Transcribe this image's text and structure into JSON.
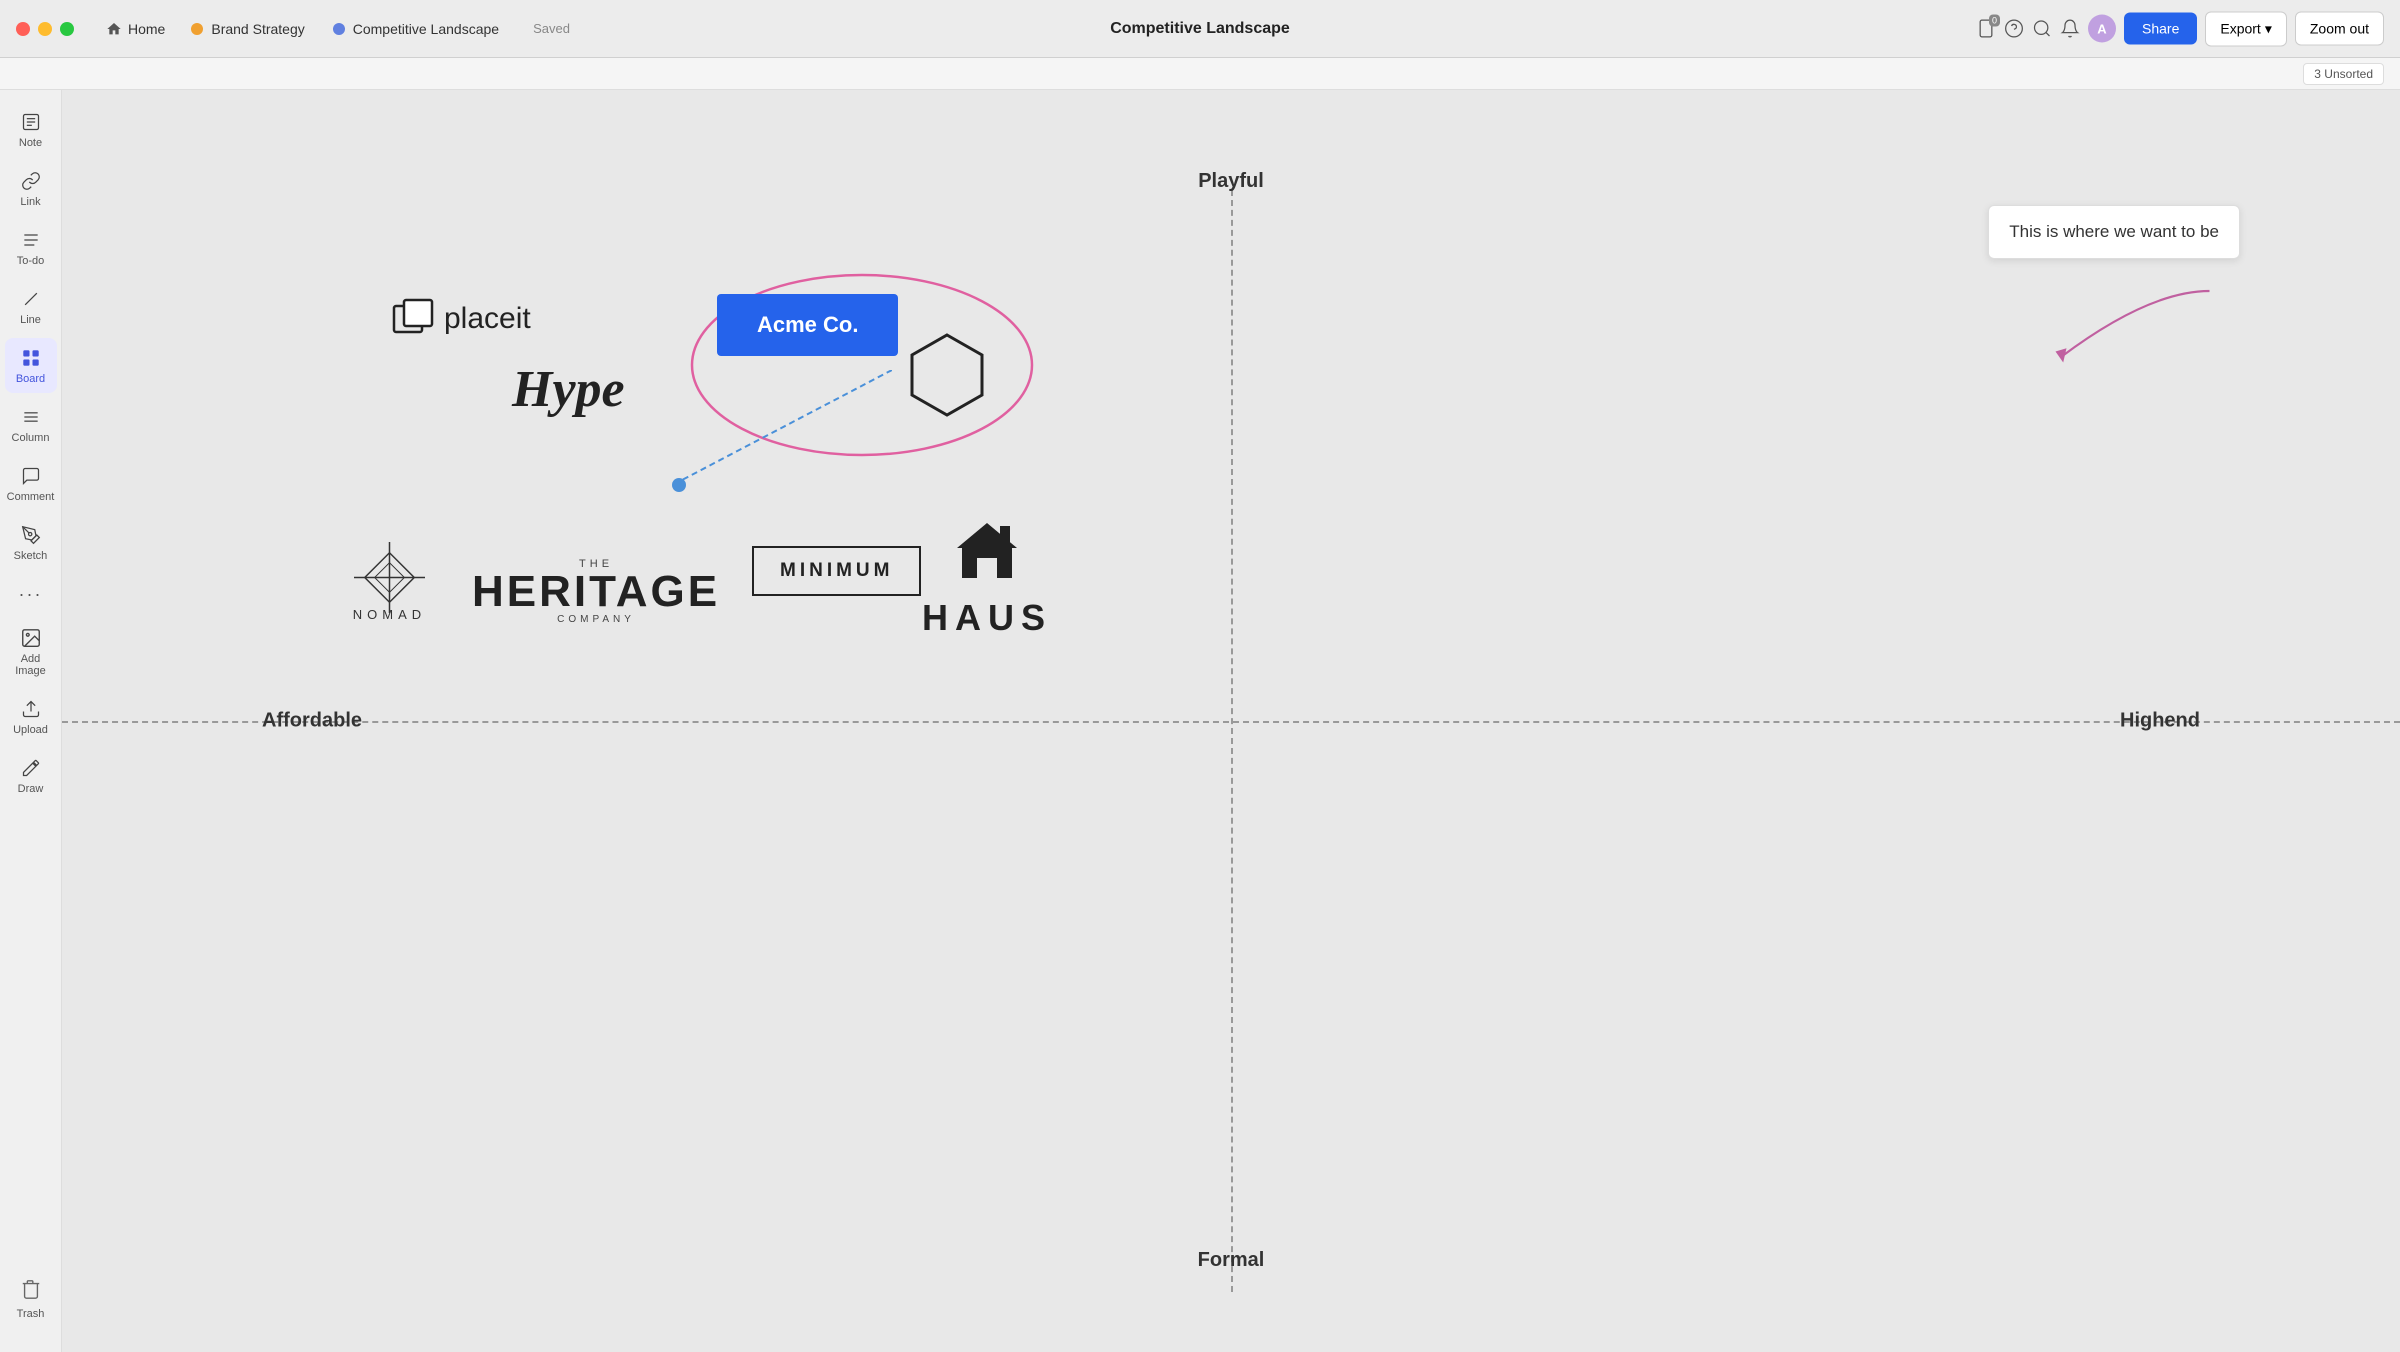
{
  "titlebar": {
    "home_label": "Home",
    "tab1_label": "Brand Strategy",
    "tab2_label": "Competitive Landscape",
    "page_title": "Competitive Landscape",
    "saved_label": "Saved",
    "share_label": "Share",
    "export_label": "Export",
    "zoomout_label": "Zoom out"
  },
  "unsorted": {
    "label": "3 Unsorted"
  },
  "sidebar": {
    "items": [
      {
        "id": "note",
        "label": "Note",
        "icon": "≡"
      },
      {
        "id": "link",
        "label": "Link",
        "icon": "🔗"
      },
      {
        "id": "todo",
        "label": "To-do",
        "icon": "☰"
      },
      {
        "id": "line",
        "label": "Line",
        "icon": "✏"
      },
      {
        "id": "board",
        "label": "Board",
        "icon": "⊞"
      },
      {
        "id": "column",
        "label": "Column",
        "icon": "—"
      },
      {
        "id": "comment",
        "label": "Comment",
        "icon": "≡"
      },
      {
        "id": "sketch",
        "label": "Sketch",
        "icon": "✏"
      },
      {
        "id": "more",
        "label": "...",
        "icon": "···"
      },
      {
        "id": "addimage",
        "label": "Add Image",
        "icon": "+"
      },
      {
        "id": "upload",
        "label": "Upload",
        "icon": "↑"
      },
      {
        "id": "draw",
        "label": "Draw",
        "icon": "✏"
      }
    ],
    "trash_label": "Trash"
  },
  "canvas": {
    "label_playful": "Playful",
    "label_formal": "Formal",
    "label_affordable": "Affordable",
    "label_highend": "Highend",
    "acme_label": "Acme Co.",
    "tooltip_text": "This is where we want to be",
    "brands": {
      "placeit": "placeit",
      "hype": "Hype",
      "nomad": "NOMAD",
      "heritage_the": "THE",
      "heritage_main": "HERITAGE",
      "heritage_company": "COMPANY",
      "minimum": "MINIMUM",
      "haus": "HAUS"
    }
  }
}
